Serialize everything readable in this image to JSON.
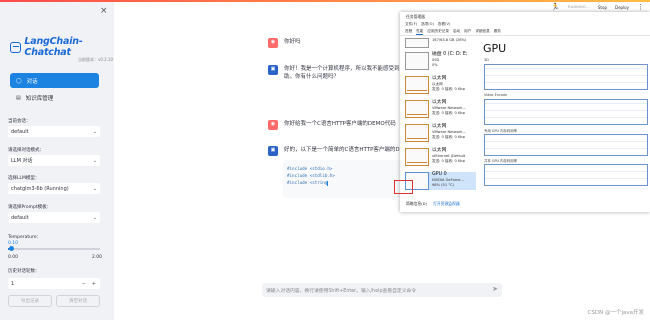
{
  "sidebar": {
    "close_icon": "×",
    "logo_text": "LangChain-Chatchat",
    "version": "当前版本：v0.2.10",
    "nav": [
      {
        "label": "对话",
        "icon": "chat-icon",
        "icon_glyph": "◯"
      },
      {
        "label": "知识库管理",
        "icon": "database-icon",
        "icon_glyph": "▤"
      }
    ],
    "fields": [
      {
        "label": "当前会话：",
        "value": "default"
      },
      {
        "label": "请选择对话模式：",
        "value": "LLM 对话"
      },
      {
        "label": "选择LLM模型：",
        "value": "chatglm3-6b (Running)"
      },
      {
        "label": "请选择Prompt模板：",
        "value": "default"
      }
    ],
    "temperature": {
      "label": "Temperature：",
      "value": "0.10",
      "min": "0.00",
      "max": "2.00",
      "fraction": 0.05
    },
    "history": {
      "label": "历史对话轮数：",
      "value": "1",
      "minus": "−",
      "plus": "+"
    },
    "export_button": "导出记录",
    "clear_button": "清空对话"
  },
  "topbar": {
    "running": "RUNNING...",
    "stop": "Stop",
    "deploy": "Deploy",
    "menu": "⋮"
  },
  "chat": {
    "messages": [
      {
        "role": "user",
        "text": "你好吗"
      },
      {
        "role": "assistant",
        "text": "你好！我是一个计算机程序，所以我不能感受到身体",
        "text2": "助。你有什么问题吗？"
      },
      {
        "role": "user",
        "text": "你好给我一个C语言HTTP客户端的DEMO代码"
      },
      {
        "role": "assistant",
        "text": "好的，以下是一个简单的C语言HTTP客户端的DEMO"
      }
    ],
    "code_lines": [
      "#include <stdio.h>",
      "#include <stdlib.h>",
      "#include <string"
    ],
    "input_placeholder": "请输入对话内容，换行请使用Shift+Enter。输入/help查看自定义命令",
    "send_icon": "➤"
  },
  "task_manager": {
    "title": "任务管理器",
    "menu": [
      "文件(F)",
      "选项(O)",
      "查看(V)"
    ],
    "tabs": [
      "进程",
      "性能",
      "应用历史记录",
      "启动",
      "用户",
      "详细信息",
      "服务"
    ],
    "active_tab": "性能",
    "items": [
      {
        "name": "",
        "detail": "167/63.8 GB (26%)",
        "style": "memory"
      },
      {
        "name": "磁盘 0 (C: D: E:",
        "detail": "SSD",
        "extra": "0%",
        "style": "disk"
      },
      {
        "name": "以太网",
        "detail": "以太网",
        "extra": "发送: 0 接收: 0 Kbp",
        "style": "eth"
      },
      {
        "name": "以太网",
        "detail": "VMware Network...",
        "extra": "发送: 0 接收: 0 Kbp",
        "style": "eth"
      },
      {
        "name": "以太网",
        "detail": "VMware Network...",
        "extra": "发送: 0 接收: 0 Kbp",
        "style": "eth"
      },
      {
        "name": "以太网",
        "detail": "vEthernet (Default",
        "extra": "发送: 0 接收: 0 Kbp",
        "style": "eth"
      },
      {
        "name": "GPU 0",
        "detail": "NVIDIA GeForce...",
        "extra": "98% (51 °C)",
        "style": "gpu"
      }
    ],
    "gpu_title": "GPU",
    "graphs": [
      "3D",
      "Video Encode",
      "专用 GPU 内存利用率",
      "共享 GPU 内存利用率"
    ],
    "footer_less": "简略信息(D)",
    "footer_link": "打开资源监视器"
  },
  "watermark": "CSDN @一个java开发"
}
